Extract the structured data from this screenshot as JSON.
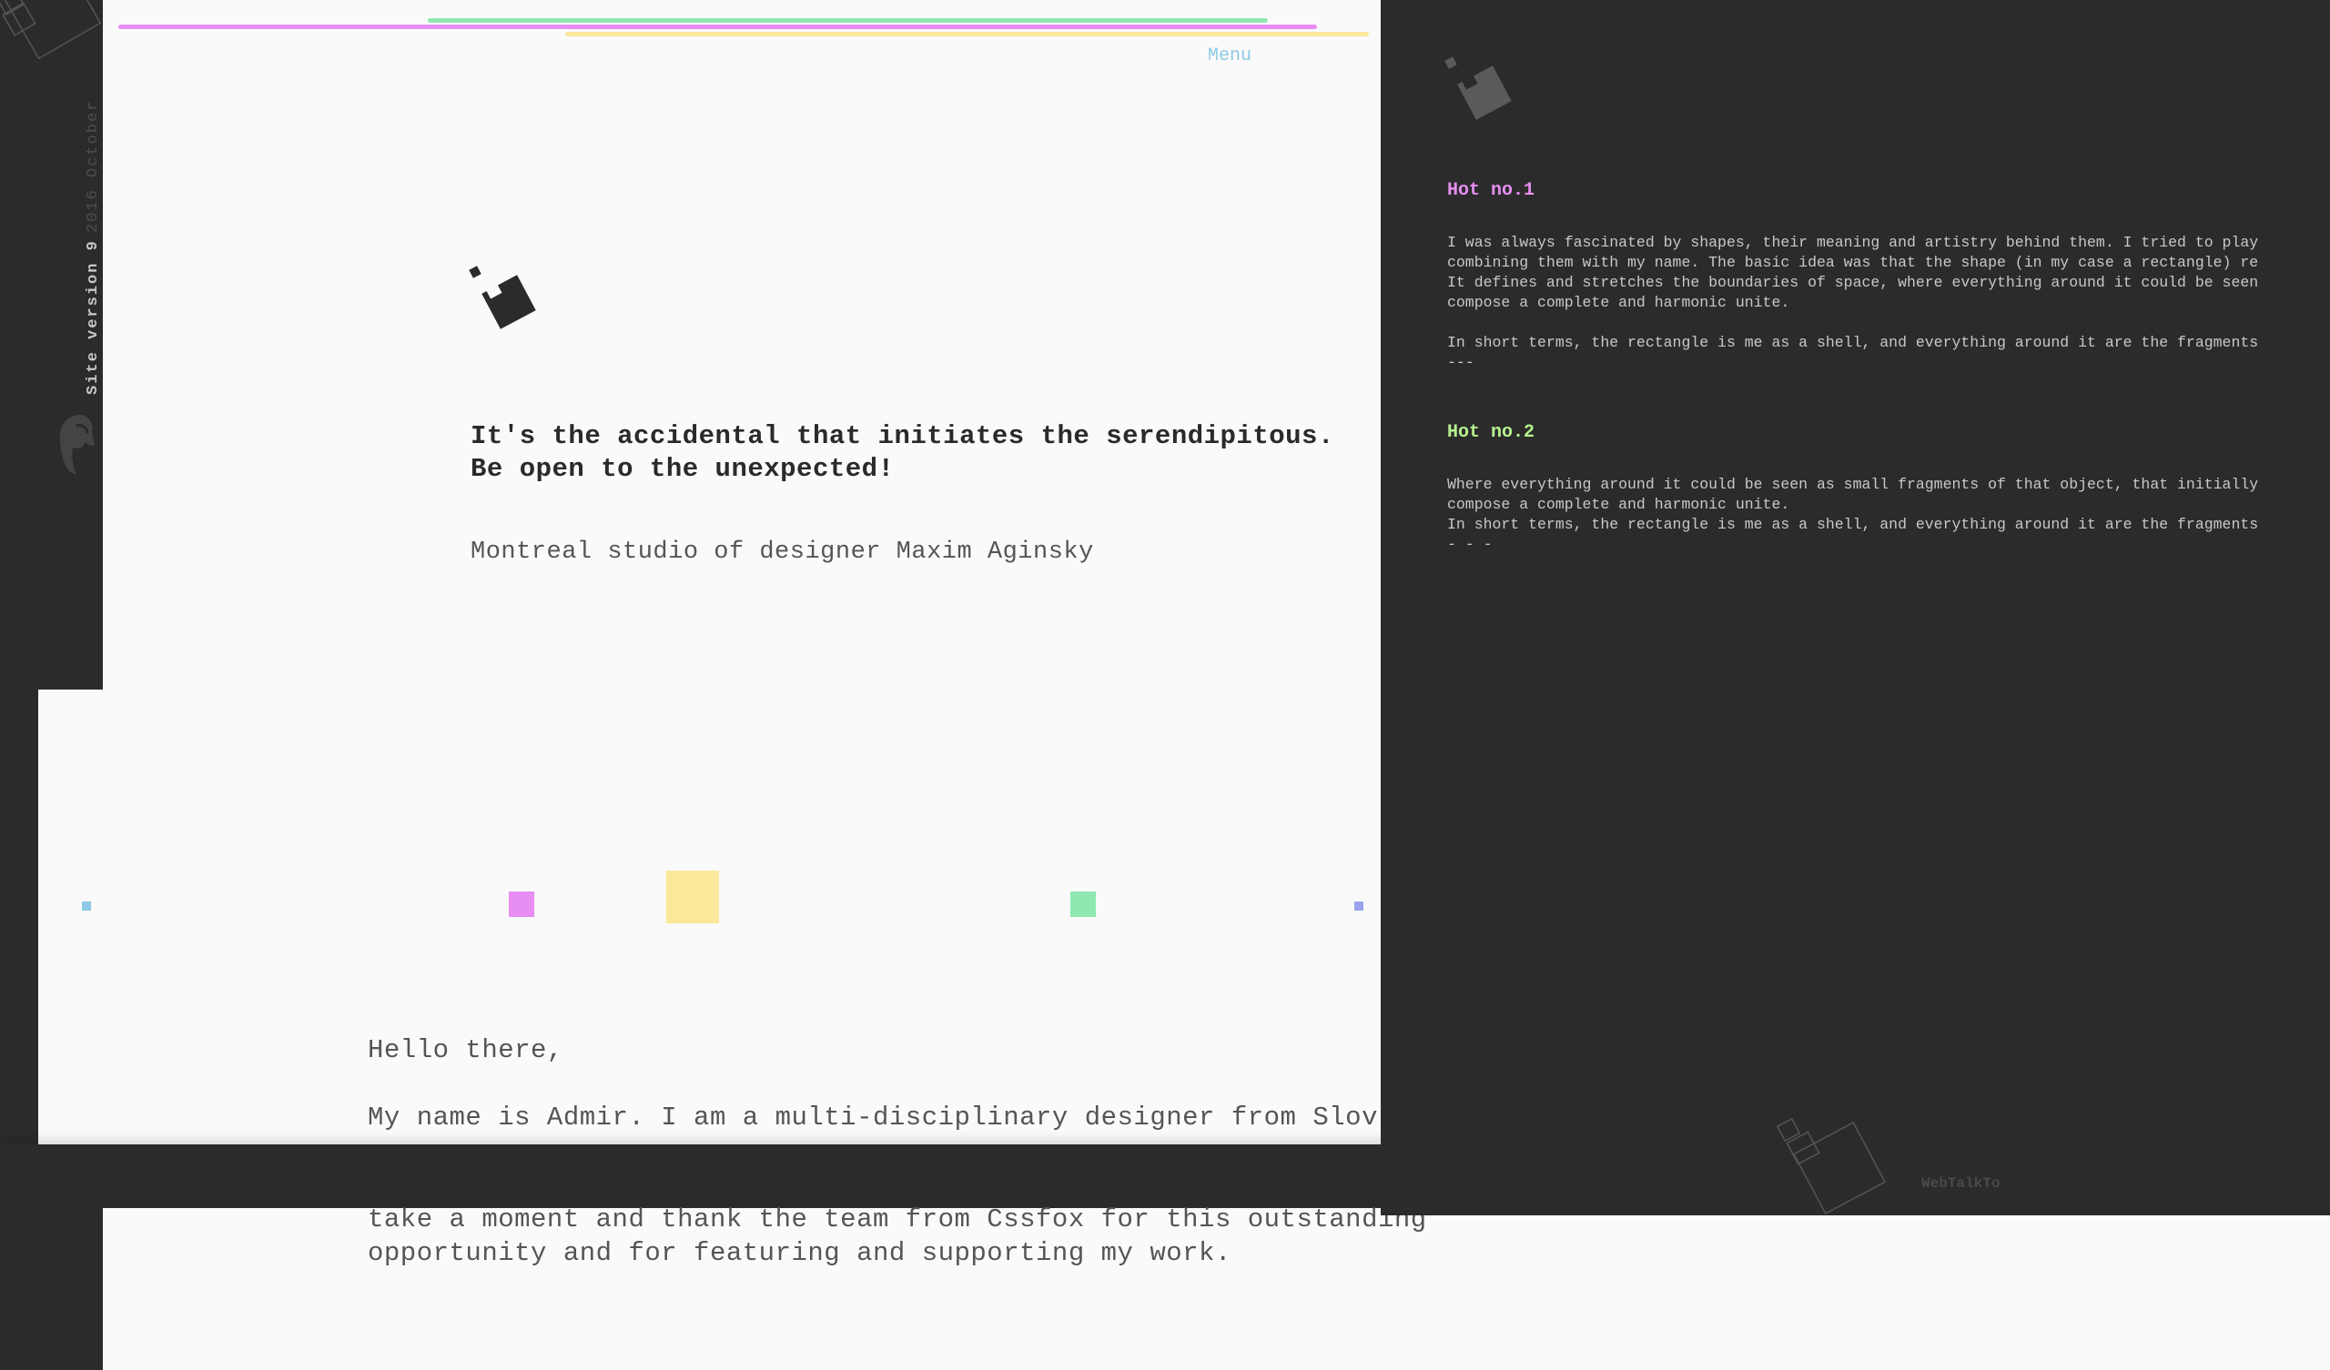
{
  "sidebar": {
    "version_label": "Site version 9",
    "date_label": "2016 October"
  },
  "header": {
    "menu_label": "Menu"
  },
  "hero": {
    "quote_line1": "It's the accidental that initiates the serendipitous.",
    "quote_line2": "Be open to the unexpected!",
    "subtitle": "Montreal studio of designer Maxim Aginsky"
  },
  "intro": {
    "greeting": "Hello there,",
    "line1": "My name is Admir. I am a multi-disciplinary designer from Slov",
    "line2": "take a moment and thank the team from Cssfox for this outstanding",
    "line3": "opportunity and for featuring and supporting my work."
  },
  "hot": [
    {
      "title": "Hot no.1",
      "lines": [
        "I was always fascinated by shapes, their meaning and artistry behind them. I tried to play",
        "combining them with my name. The basic idea was that the shape (in my case a rectangle) re",
        "It defines and stretches the boundaries of space, where everything around it could be seen",
        "compose a complete and harmonic unite.",
        "",
        "In short terms, the rectangle is me as a shell, and everything around it are the fragments",
        "---"
      ]
    },
    {
      "title": "Hot no.2",
      "lines": [
        "Where everything around it could be seen as small fragments of that object, that initially",
        "compose a complete and harmonic unite.",
        "In short terms, the rectangle is me as a shell, and everything around it are the fragments",
        "- - -"
      ]
    }
  ],
  "footer": {
    "brand": "WebTalkTo"
  },
  "colors": {
    "pink": "#e88ef2",
    "green": "#8ee8b0",
    "yellow": "#fbe89a",
    "blue": "#8ecae6",
    "indigo": "#9aa2ee",
    "dark": "#2b2b2b",
    "light": "#fafafa"
  }
}
